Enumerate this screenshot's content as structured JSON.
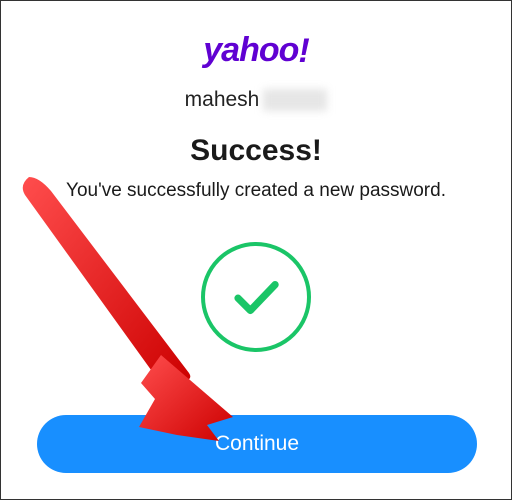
{
  "brand": {
    "logo_text": "yahoo",
    "logo_bang": "!"
  },
  "account": {
    "username_visible": "mahesh"
  },
  "content": {
    "heading": "Success!",
    "subtext": "You've successfully created a new password."
  },
  "actions": {
    "continue_label": "Continue"
  },
  "colors": {
    "brand_purple": "#6001d2",
    "success_green": "#1ac567",
    "primary_blue": "#188fff",
    "annotation_red": "#ff0000"
  },
  "icons": {
    "success_check": "checkmark-icon"
  }
}
